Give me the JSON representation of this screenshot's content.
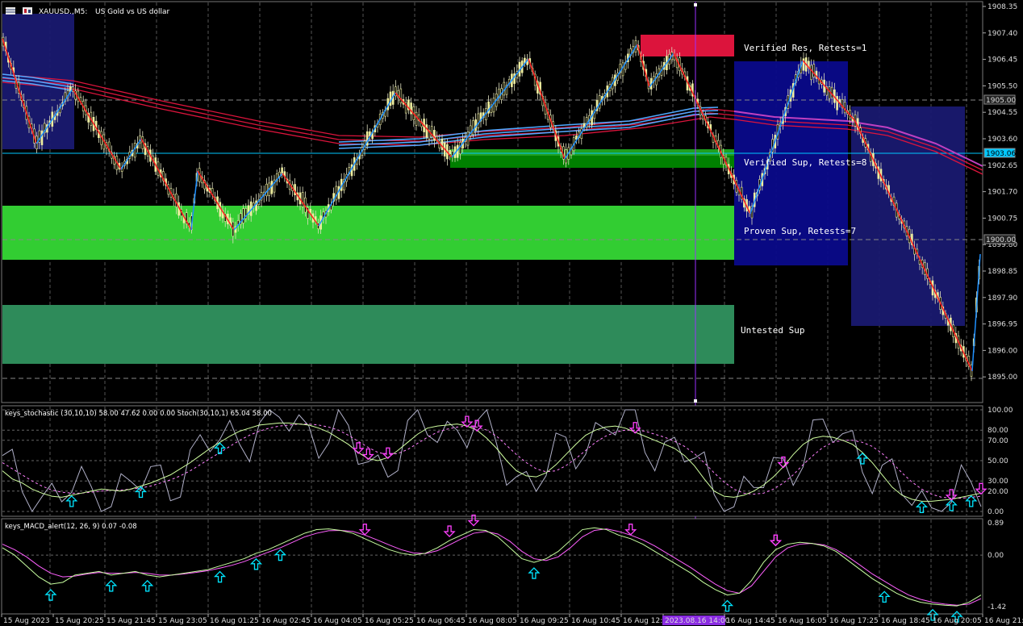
{
  "chart": {
    "symbol": "XAUUSD.,M5:",
    "description": "US Gold vs US dollar"
  },
  "zones": {
    "verified_res": "Verified Res, Retests=1",
    "verified_sup": "Verified Sup, Retests=8",
    "proven_sup": "Proven Sup, Retests=7",
    "untested_sup": "Untested Sup"
  },
  "price_axis": {
    "ticks": [
      "1908.35",
      "1907.40",
      "1906.45",
      "1905.50",
      "1904.55",
      "1903.60",
      "1902.65",
      "1901.70",
      "1900.75",
      "1899.80",
      "1898.85",
      "1897.90",
      "1896.95",
      "1896.00",
      "1895.00"
    ],
    "current_price": "1903.06",
    "box_1905": "1905.00",
    "box_1900": "1900.00",
    "box_1895": "1895.00",
    "current_color": "#00c8ff"
  },
  "stochastic": {
    "title": "keys_stochastic (30,10,10) 58.00 47.62 0.00 0.00 Stoch(30,10,1) 65.04 58.00",
    "ticks": [
      "100.00",
      "80.00",
      "70.00",
      "50.00",
      "30.00",
      "20.00",
      "0.00"
    ],
    "main_values": [
      40,
      32,
      28,
      22,
      18,
      15,
      14,
      16,
      18,
      20,
      22,
      21,
      20,
      22,
      25,
      28,
      32,
      36,
      42,
      48,
      55,
      62,
      68,
      74,
      79,
      82,
      85,
      86,
      87,
      87,
      86,
      85,
      82,
      78,
      72,
      66,
      58,
      52,
      50,
      53,
      60,
      68,
      76,
      82,
      84,
      85,
      86,
      84,
      80,
      72,
      62,
      50,
      40,
      35,
      34,
      38,
      46,
      56,
      66,
      75,
      80,
      83,
      84,
      82,
      78,
      74,
      70,
      66,
      62,
      55,
      45,
      32,
      20,
      15,
      14,
      16,
      20,
      26,
      34,
      44,
      56,
      66,
      72,
      74,
      73,
      70,
      66,
      58,
      48,
      36,
      24,
      16,
      12,
      10,
      10,
      11,
      12,
      14,
      16,
      18
    ],
    "signal_values": [
      48,
      42,
      36,
      30,
      25,
      21,
      19,
      18,
      18,
      19,
      20,
      21,
      21,
      22,
      23,
      25,
      28,
      31,
      35,
      40,
      46,
      52,
      58,
      64,
      70,
      75,
      79,
      82,
      84,
      85,
      86,
      86,
      85,
      83,
      80,
      75,
      69,
      63,
      58,
      56,
      57,
      61,
      67,
      73,
      78,
      81,
      83,
      84,
      83,
      80,
      74,
      65,
      56,
      48,
      42,
      39,
      40,
      45,
      52,
      60,
      68,
      74,
      78,
      80,
      80,
      79,
      76,
      73,
      69,
      64,
      57,
      48,
      38,
      29,
      22,
      18,
      17,
      18,
      22,
      28,
      36,
      46,
      55,
      63,
      68,
      70,
      70,
      68,
      64,
      57,
      48,
      38,
      29,
      22,
      17,
      14,
      13,
      13,
      14,
      15
    ],
    "up_arrow_idx": [
      7,
      14,
      22,
      87,
      93,
      96,
      98
    ],
    "down_arrow_idx": [
      36,
      37,
      39,
      47,
      48,
      64,
      79,
      96,
      99
    ]
  },
  "macd": {
    "title": "keys_MACD_alert(12, 26, 9) 0.07 -0.08",
    "ticks": [
      "0.89",
      "0.00",
      "-1.42"
    ],
    "main_values": [
      0.2,
      0.0,
      -0.3,
      -0.6,
      -0.8,
      -0.75,
      -0.55,
      -0.5,
      -0.45,
      -0.55,
      -0.5,
      -0.45,
      -0.55,
      -0.6,
      -0.55,
      -0.5,
      -0.45,
      -0.4,
      -0.3,
      -0.2,
      -0.1,
      0.05,
      0.15,
      0.3,
      0.45,
      0.6,
      0.7,
      0.72,
      0.68,
      0.6,
      0.45,
      0.3,
      0.15,
      0.05,
      0.0,
      0.05,
      0.2,
      0.4,
      0.55,
      0.7,
      0.68,
      0.5,
      0.2,
      -0.1,
      -0.2,
      -0.1,
      0.1,
      0.4,
      0.7,
      0.75,
      0.7,
      0.55,
      0.45,
      0.3,
      0.1,
      -0.1,
      -0.3,
      -0.5,
      -0.75,
      -0.95,
      -1.1,
      -1.05,
      -0.7,
      -0.2,
      0.15,
      0.3,
      0.35,
      0.32,
      0.25,
      0.1,
      -0.15,
      -0.4,
      -0.65,
      -0.85,
      -1.05,
      -1.2,
      -1.3,
      -1.35,
      -1.38,
      -1.4,
      -1.3,
      -1.1
    ],
    "signal_values": [
      0.3,
      0.15,
      -0.05,
      -0.3,
      -0.5,
      -0.6,
      -0.58,
      -0.52,
      -0.48,
      -0.5,
      -0.5,
      -0.48,
      -0.5,
      -0.55,
      -0.55,
      -0.52,
      -0.48,
      -0.43,
      -0.36,
      -0.28,
      -0.18,
      -0.05,
      0.08,
      0.2,
      0.35,
      0.5,
      0.6,
      0.67,
      0.68,
      0.65,
      0.55,
      0.42,
      0.28,
      0.15,
      0.06,
      0.04,
      0.12,
      0.28,
      0.45,
      0.6,
      0.65,
      0.58,
      0.38,
      0.1,
      -0.1,
      -0.15,
      -0.05,
      0.2,
      0.5,
      0.68,
      0.72,
      0.65,
      0.55,
      0.42,
      0.25,
      0.05,
      -0.15,
      -0.35,
      -0.58,
      -0.8,
      -0.98,
      -1.05,
      -0.85,
      -0.45,
      -0.05,
      0.2,
      0.3,
      0.32,
      0.28,
      0.15,
      -0.05,
      -0.28,
      -0.52,
      -0.72,
      -0.92,
      -1.1,
      -1.22,
      -1.3,
      -1.35,
      -1.38,
      -1.35,
      -1.2
    ],
    "up_arrow_idx": [
      4,
      9,
      12,
      18,
      21,
      23,
      44,
      60,
      73,
      77,
      79
    ],
    "down_arrow_idx": [
      30,
      37,
      39,
      52,
      64,
      64
    ]
  },
  "time_axis": {
    "labels": [
      "15 Aug 2023",
      "15 Aug 20:25",
      "15 Aug 21:45",
      "15 Aug 23:05",
      "16 Aug 01:25",
      "16 Aug 02:45",
      "16 Aug 04:05",
      "16 Aug 05:25",
      "16 Aug 06:45",
      "16 Aug 08:05",
      "16 Aug 09:25",
      "16 Aug 10:45",
      "16 Aug 12:05",
      "2023.08.16 14:00",
      "16 Aug 14:45",
      "16 Aug 16:05",
      "16 Aug 17:25",
      "16 Aug 18:45",
      "16 Aug 20:05",
      "16 Aug 21:2"
    ],
    "cursor_label": "2023.08.16 14:00"
  }
}
